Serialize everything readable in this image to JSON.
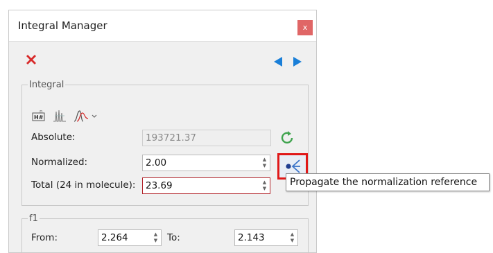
{
  "window": {
    "title": "Integral Manager",
    "close_glyph": "x"
  },
  "toolbar": {
    "delete_icon": "red-x-delete-icon",
    "prev_icon": "blue-triangle-left-icon",
    "next_icon": "blue-triangle-right-icon"
  },
  "integral_group": {
    "legend": "Integral",
    "tools": [
      "h-number-icon",
      "multiplet-peaks-icon",
      "integral-curve-icon"
    ],
    "absolute_label": "Absolute:",
    "absolute_value": "193721.37",
    "normalized_label": "Normalized:",
    "normalized_value": "2.00",
    "total_label": "Total (24 in molecule):",
    "total_value": "23.69"
  },
  "f1_group": {
    "legend": "f1",
    "from_label": "From:",
    "from_value": "2.264",
    "to_label": "To:",
    "to_value": "2.143"
  },
  "tooltip": {
    "text": "Propagate the normalization reference"
  },
  "colors": {
    "delete_red": "#d82a2a",
    "nav_blue": "#1a7fd8",
    "refresh_green": "#3fa34d",
    "highlight_red": "#e01818",
    "close_bg": "#e06666"
  }
}
